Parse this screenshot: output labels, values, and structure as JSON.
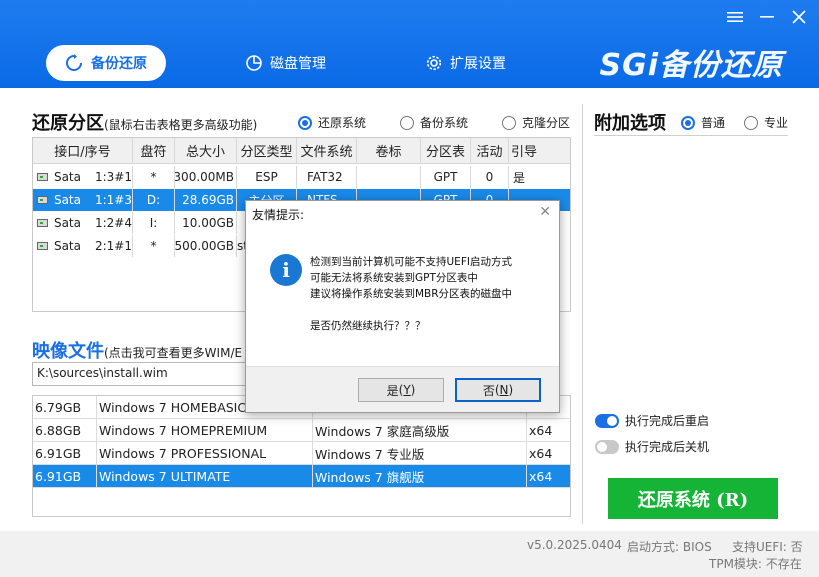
{
  "header": {
    "tabs": [
      {
        "label": "备份还原",
        "icon": "restore-icon"
      },
      {
        "label": "磁盘管理",
        "icon": "pie-chart-icon"
      },
      {
        "label": "扩展设置",
        "icon": "gear-icon"
      }
    ],
    "logo": "SGi备份还原"
  },
  "partition": {
    "title": "还原分区",
    "note": "(鼠标右击表格更多高级功能)",
    "modes": [
      {
        "label": "还原系统",
        "selected": true
      },
      {
        "label": "备份系统",
        "selected": false
      },
      {
        "label": "克隆分区",
        "selected": false
      }
    ],
    "columns": [
      "接口/序号",
      "盘符",
      "总大小",
      "分区类型",
      "文件系统",
      "卷标",
      "分区表",
      "活动",
      "引导"
    ],
    "rows": [
      {
        "iface": "Sata",
        "num": "1:3#1",
        "letter": "*",
        "size": "300.00MB",
        "ptype": "ESP",
        "fs": "FAT32",
        "label": "",
        "table": "GPT",
        "active": "0",
        "boot": "是",
        "selected": false
      },
      {
        "iface": "Sata",
        "num": "1:1#3",
        "letter": "D:",
        "size": "28.69GB",
        "ptype": "主分区",
        "fs": "NTFS",
        "label": "",
        "table": "GPT",
        "active": "0",
        "boot": "",
        "selected": true
      },
      {
        "iface": "Sata",
        "num": "1:2#4",
        "letter": "I:",
        "size": "10.00GB",
        "ptype": "",
        "fs": "",
        "label": "",
        "table": "",
        "active": "",
        "boot": "",
        "selected": false
      },
      {
        "iface": "Sata",
        "num": "2:1#1",
        "letter": "*",
        "size": "500.00GB",
        "ptype": "st",
        "fs": "",
        "label": "",
        "table": "",
        "active": "",
        "boot": "",
        "selected": false
      }
    ]
  },
  "image": {
    "title": "映像文件",
    "note": "(点击我可查看更多WIM/E",
    "path": "K:\\sources\\install.wim",
    "rows": [
      {
        "size": "6.79GB",
        "name": "Windows 7 HOMEBASIC",
        "desc": "",
        "arch": "",
        "selected": false
      },
      {
        "size": "6.88GB",
        "name": "Windows 7 HOMEPREMIUM",
        "desc": "Windows 7 家庭高级版",
        "arch": "x64",
        "selected": false
      },
      {
        "size": "6.91GB",
        "name": "Windows 7 PROFESSIONAL",
        "desc": "Windows 7 专业版",
        "arch": "x64",
        "selected": false
      },
      {
        "size": "6.91GB",
        "name": "Windows 7 ULTIMATE",
        "desc": "Windows 7 旗舰版",
        "arch": "x64",
        "selected": true
      }
    ]
  },
  "options": {
    "title": "附加选项",
    "modes": [
      {
        "label": "普通",
        "selected": true
      },
      {
        "label": "专业",
        "selected": false
      }
    ],
    "toggles": [
      {
        "label": "执行完成后重启",
        "on": true
      },
      {
        "label": "执行完成后关机",
        "on": false
      }
    ],
    "restore_button": "还原系统 (R)"
  },
  "footer": {
    "version": "v5.0.2025.0404",
    "boot_mode": "启动方式: BIOS",
    "uefi": "支持UEFI: 否",
    "tpm": "TPM模块: 不存在"
  },
  "dialog": {
    "title": "友情提示:",
    "line1": "检测到当前计算机可能不支持UEFI启动方式",
    "line2": "可能无法将系统安装到GPT分区表中",
    "line3": "建议将操作系统安装到MBR分区表的磁盘中",
    "line4": "是否仍然继续执行？？？",
    "yes_label": "是",
    "yes_key": "Y",
    "no_label": "否",
    "no_key": "N"
  }
}
